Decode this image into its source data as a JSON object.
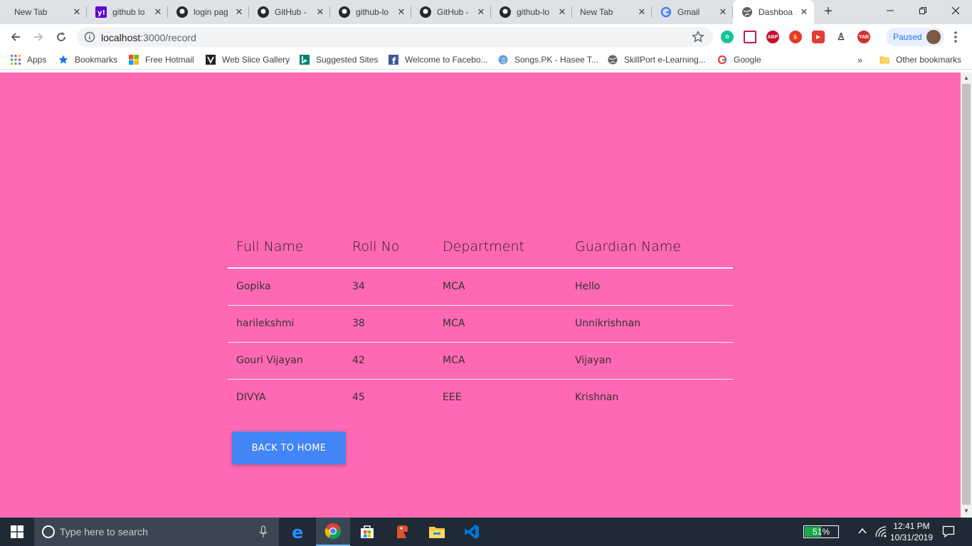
{
  "browser": {
    "tabs": [
      {
        "title": "New Tab",
        "icon": "none"
      },
      {
        "title": "github lo",
        "icon": "yahoo-icon"
      },
      {
        "title": "login pag",
        "icon": "github-icon"
      },
      {
        "title": "GitHub - ",
        "icon": "github-icon"
      },
      {
        "title": "github-lo",
        "icon": "github-icon"
      },
      {
        "title": "GitHub - ",
        "icon": "github-icon"
      },
      {
        "title": "github-lo",
        "icon": "github-icon"
      },
      {
        "title": "New Tab",
        "icon": "none"
      },
      {
        "title": "Gmail",
        "icon": "google-icon"
      },
      {
        "title": "Dashboa",
        "icon": "globe-icon"
      }
    ],
    "url_host": "localhost",
    "url_path": ":3000/record",
    "profile_status": "Paused",
    "extension_labels": {
      "abp": "ABP",
      "yab": "YAB"
    },
    "bookmarks": [
      {
        "label": "Apps"
      },
      {
        "label": "Bookmarks"
      },
      {
        "label": "Free Hotmail"
      },
      {
        "label": "Web Slice Gallery"
      },
      {
        "label": "Suggested Sites"
      },
      {
        "label": "Welcome to Facebo..."
      },
      {
        "label": "Songs.PK - Hasee T..."
      },
      {
        "label": "SkillPort e-Learning..."
      },
      {
        "label": "Google"
      }
    ],
    "overflow": "»",
    "other_bookmarks": "Other bookmarks"
  },
  "page": {
    "background": "#ff69b4",
    "table": {
      "headers": [
        "Full Name",
        "Roll No",
        "Department",
        "Guardian Name"
      ],
      "rows": [
        [
          "Gopika",
          "34",
          "MCA",
          "Hello"
        ],
        [
          "harilekshmi",
          "38",
          "MCA",
          "Unnikrishnan"
        ],
        [
          "Gouri Vijayan",
          "42",
          "MCA",
          "Vijayan"
        ],
        [
          "DIVYA",
          "45",
          "EEE",
          "Krishnan"
        ]
      ]
    },
    "back_button": "BACK TO HOME"
  },
  "taskbar": {
    "search_placeholder": "Type here to search",
    "battery_percent": 51,
    "battery_label": "51%",
    "time": "12:41 PM",
    "date": "10/31/2019"
  }
}
